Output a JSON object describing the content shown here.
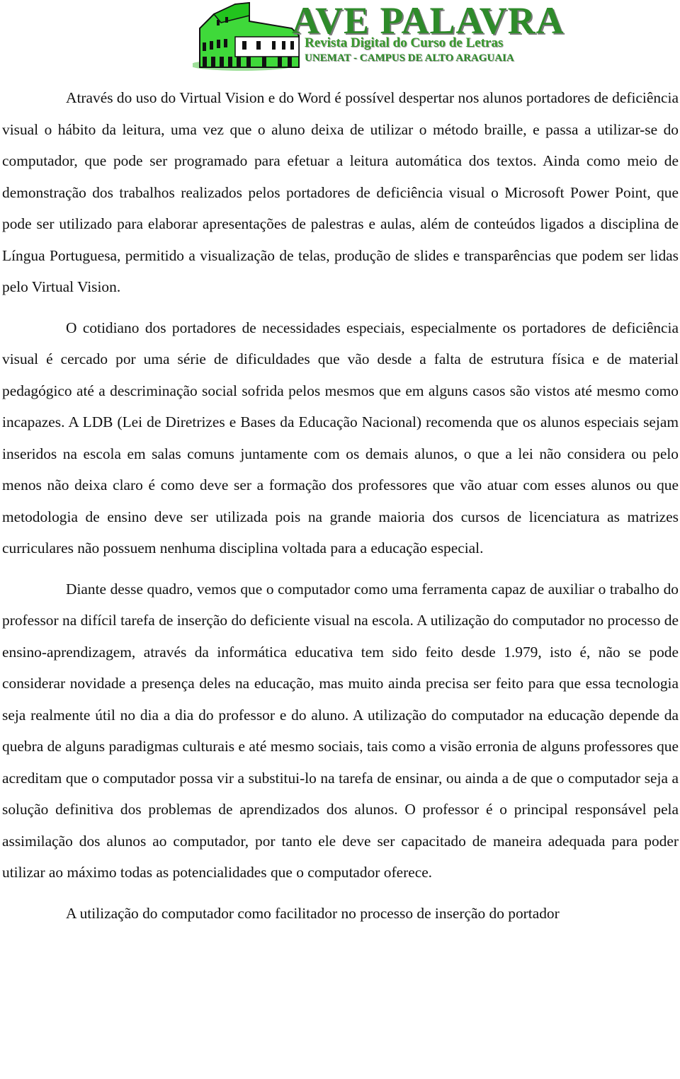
{
  "header": {
    "title": "AVE PALAVRA",
    "subtitle": "Revista Digital do Curso de Letras",
    "campus": "UNEMAT - CAMPUS DE ALTO ARAGUAIA",
    "logo_icon": "coliseum-icon",
    "brand_color": "#2e8b2a"
  },
  "document": {
    "paragraphs": [
      "Através do uso do Virtual Vision e do Word é possível despertar nos alunos portadores de deficiência visual o hábito da leitura, uma vez que o aluno deixa de utilizar o método braille, e passa a utilizar-se do computador, que pode ser programado para efetuar a leitura automática dos textos.   Ainda como meio de demonstração dos trabalhos realizados pelos portadores de deficiência visual o Microsoft Power Point, que pode ser utilizado para elaborar apresentações de palestras e aulas, além de conteúdos ligados a disciplina de Língua Portuguesa, permitido a visualização de telas, produção de slides e transparências que podem ser lidas pelo Virtual Vision.",
      "O cotidiano dos portadores de necessidades especiais, especialmente os portadores de deficiência visual é cercado por uma série de dificuldades que vão desde a falta de estrutura física e de material pedagógico até a descriminação social sofrida pelos mesmos que em alguns casos são vistos até mesmo como incapazes. A LDB (Lei de Diretrizes e Bases da Educação Nacional) recomenda que os alunos especiais sejam inseridos na escola em salas comuns juntamente com os demais alunos, o que a lei não considera ou pelo menos não deixa claro é como deve ser a formação dos professores que vão atuar com esses alunos ou que metodologia de ensino deve ser utilizada pois na grande maioria dos cursos de licenciatura as matrizes curriculares não  possuem nenhuma disciplina voltada  para a educação especial.",
      "Diante desse quadro, vemos que o computador como uma ferramenta capaz de auxiliar o trabalho do professor na difícil tarefa de inserção do deficiente visual na escola. A utilização do computador no processo de ensino-aprendizagem, através da informática educativa tem sido feito desde 1.979, isto é, não se pode considerar novidade a presença deles na educação, mas muito ainda precisa ser feito para que essa tecnologia seja realmente útil no dia a dia do professor e do aluno. A utilização do computador na educação depende da quebra de alguns paradigmas culturais e até mesmo sociais, tais como a visão erronia de alguns professores que acreditam que o computador possa vir a substitui-lo na tarefa de ensinar, ou ainda a de que o computador seja a solução definitiva dos problemas de aprendizados dos alunos. O professor é o principal responsável pela assimilação dos alunos ao  computador, por tanto ele deve ser capacitado de maneira adequada para poder utilizar ao máximo todas as potencialidades que o computador oferece.",
      "A utilização do computador como facilitador no processo de inserção do portador"
    ]
  }
}
